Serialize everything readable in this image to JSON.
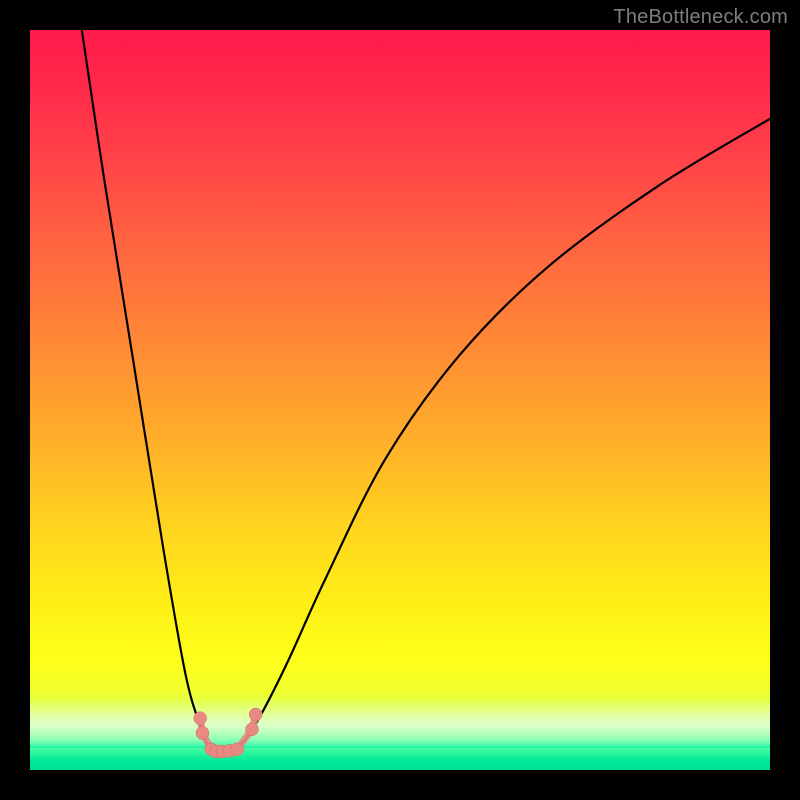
{
  "watermark": "TheBottleneck.com",
  "chart_data": {
    "type": "line",
    "title": "",
    "xlabel": "",
    "ylabel": "",
    "xlim": [
      0,
      100
    ],
    "ylim": [
      0,
      100
    ],
    "grid": false,
    "legend": false,
    "background": {
      "type": "vertical-gradient",
      "stops": [
        {
          "pos": 0.0,
          "color": "#ff1a4b",
          "meaning": "bottleneck-high"
        },
        {
          "pos": 0.5,
          "color": "#ff8a35"
        },
        {
          "pos": 0.8,
          "color": "#ffef16"
        },
        {
          "pos": 0.97,
          "color": "#5effa0"
        },
        {
          "pos": 1.0,
          "color": "#00df97",
          "meaning": "bottleneck-none"
        }
      ]
    },
    "series": [
      {
        "name": "bottleneck-curve",
        "color": "#000000",
        "x": [
          7,
          10,
          14,
          18,
          21,
          23,
          24.5,
          25.5,
          27,
          29,
          31.5,
          35,
          40,
          48,
          58,
          70,
          85,
          100
        ],
        "y": [
          100,
          80,
          55,
          30,
          13,
          6,
          2.5,
          2.5,
          2.8,
          4,
          8,
          15,
          26,
          42,
          56,
          68,
          79,
          88
        ]
      }
    ],
    "markers": [
      {
        "name": "salmon-cluster",
        "shape": "bead-string",
        "color": "#e98a82",
        "points": [
          {
            "x": 23.0,
            "y": 7.0
          },
          {
            "x": 23.3,
            "y": 5.0
          },
          {
            "x": 24.5,
            "y": 2.8
          },
          {
            "x": 25.2,
            "y": 2.5
          },
          {
            "x": 26.0,
            "y": 2.5
          },
          {
            "x": 27.0,
            "y": 2.6
          },
          {
            "x": 28.0,
            "y": 2.8
          },
          {
            "x": 30.0,
            "y": 5.5
          },
          {
            "x": 30.5,
            "y": 7.5
          }
        ]
      }
    ]
  }
}
